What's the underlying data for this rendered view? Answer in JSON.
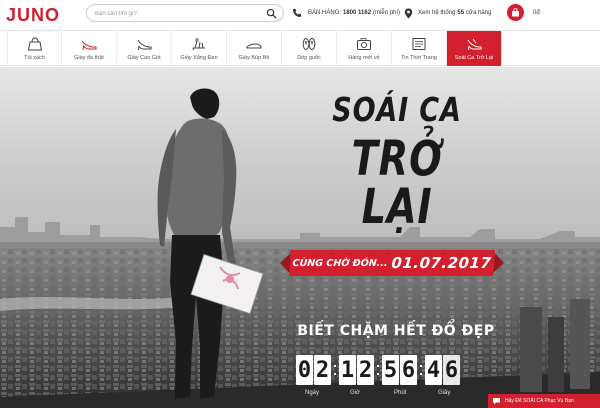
{
  "header": {
    "logo": "JUNO",
    "search_placeholder": "Bạn cần tìm gì?",
    "hotline_prefix": "BÁN HÀNG:",
    "hotline_number": "1800 1162",
    "hotline_suffix": "(miễn phí)",
    "stores_prefix": "Xem hệ thống",
    "stores_count": "55",
    "stores_suffix": "cửa hàng",
    "cart_value": "0đ"
  },
  "nav": {
    "items": [
      {
        "label": "Túi xách",
        "icon": "handbag-icon",
        "active": false
      },
      {
        "label": "Giày đa thật",
        "icon": "leather-heel-icon",
        "active": false
      },
      {
        "label": "Giày Cao Gót",
        "icon": "high-heel-icon",
        "active": false
      },
      {
        "label": "Giày Xăng Đan",
        "icon": "sandal-icon",
        "active": false
      },
      {
        "label": "Giày Búp Bê",
        "icon": "flat-shoe-icon",
        "active": false
      },
      {
        "label": "Dép guốc",
        "icon": "flip-flop-icon",
        "active": false
      },
      {
        "label": "Hàng mới về",
        "icon": "camera-icon",
        "active": false
      },
      {
        "label": "Tin Thời Trang",
        "icon": "newspaper-icon",
        "active": false
      },
      {
        "label": "Soái Ca Trở Lại",
        "icon": "tag-heel-icon",
        "active": true
      }
    ]
  },
  "hero": {
    "headline_line1": "SOÁI CA",
    "headline_line2": "TRỞ LẠI",
    "ribbon_lead": "CÙNG CHỜ ĐÓN...",
    "ribbon_date": "01.07.2017",
    "tagline": "BIẾT CHẶM HẾT ĐỔ ĐẸP",
    "countdown": {
      "digits": [
        "0",
        "2",
        "1",
        "2",
        "5",
        "6",
        "4",
        "6"
      ],
      "labels": [
        "Ngày",
        "Giờ",
        "Phút",
        "Giây"
      ]
    }
  },
  "chat": {
    "label": "Hãy Để SOÁI CA Phục Vụ Bạn"
  },
  "colors": {
    "brand_red": "#d2202f",
    "text": "#333333"
  }
}
